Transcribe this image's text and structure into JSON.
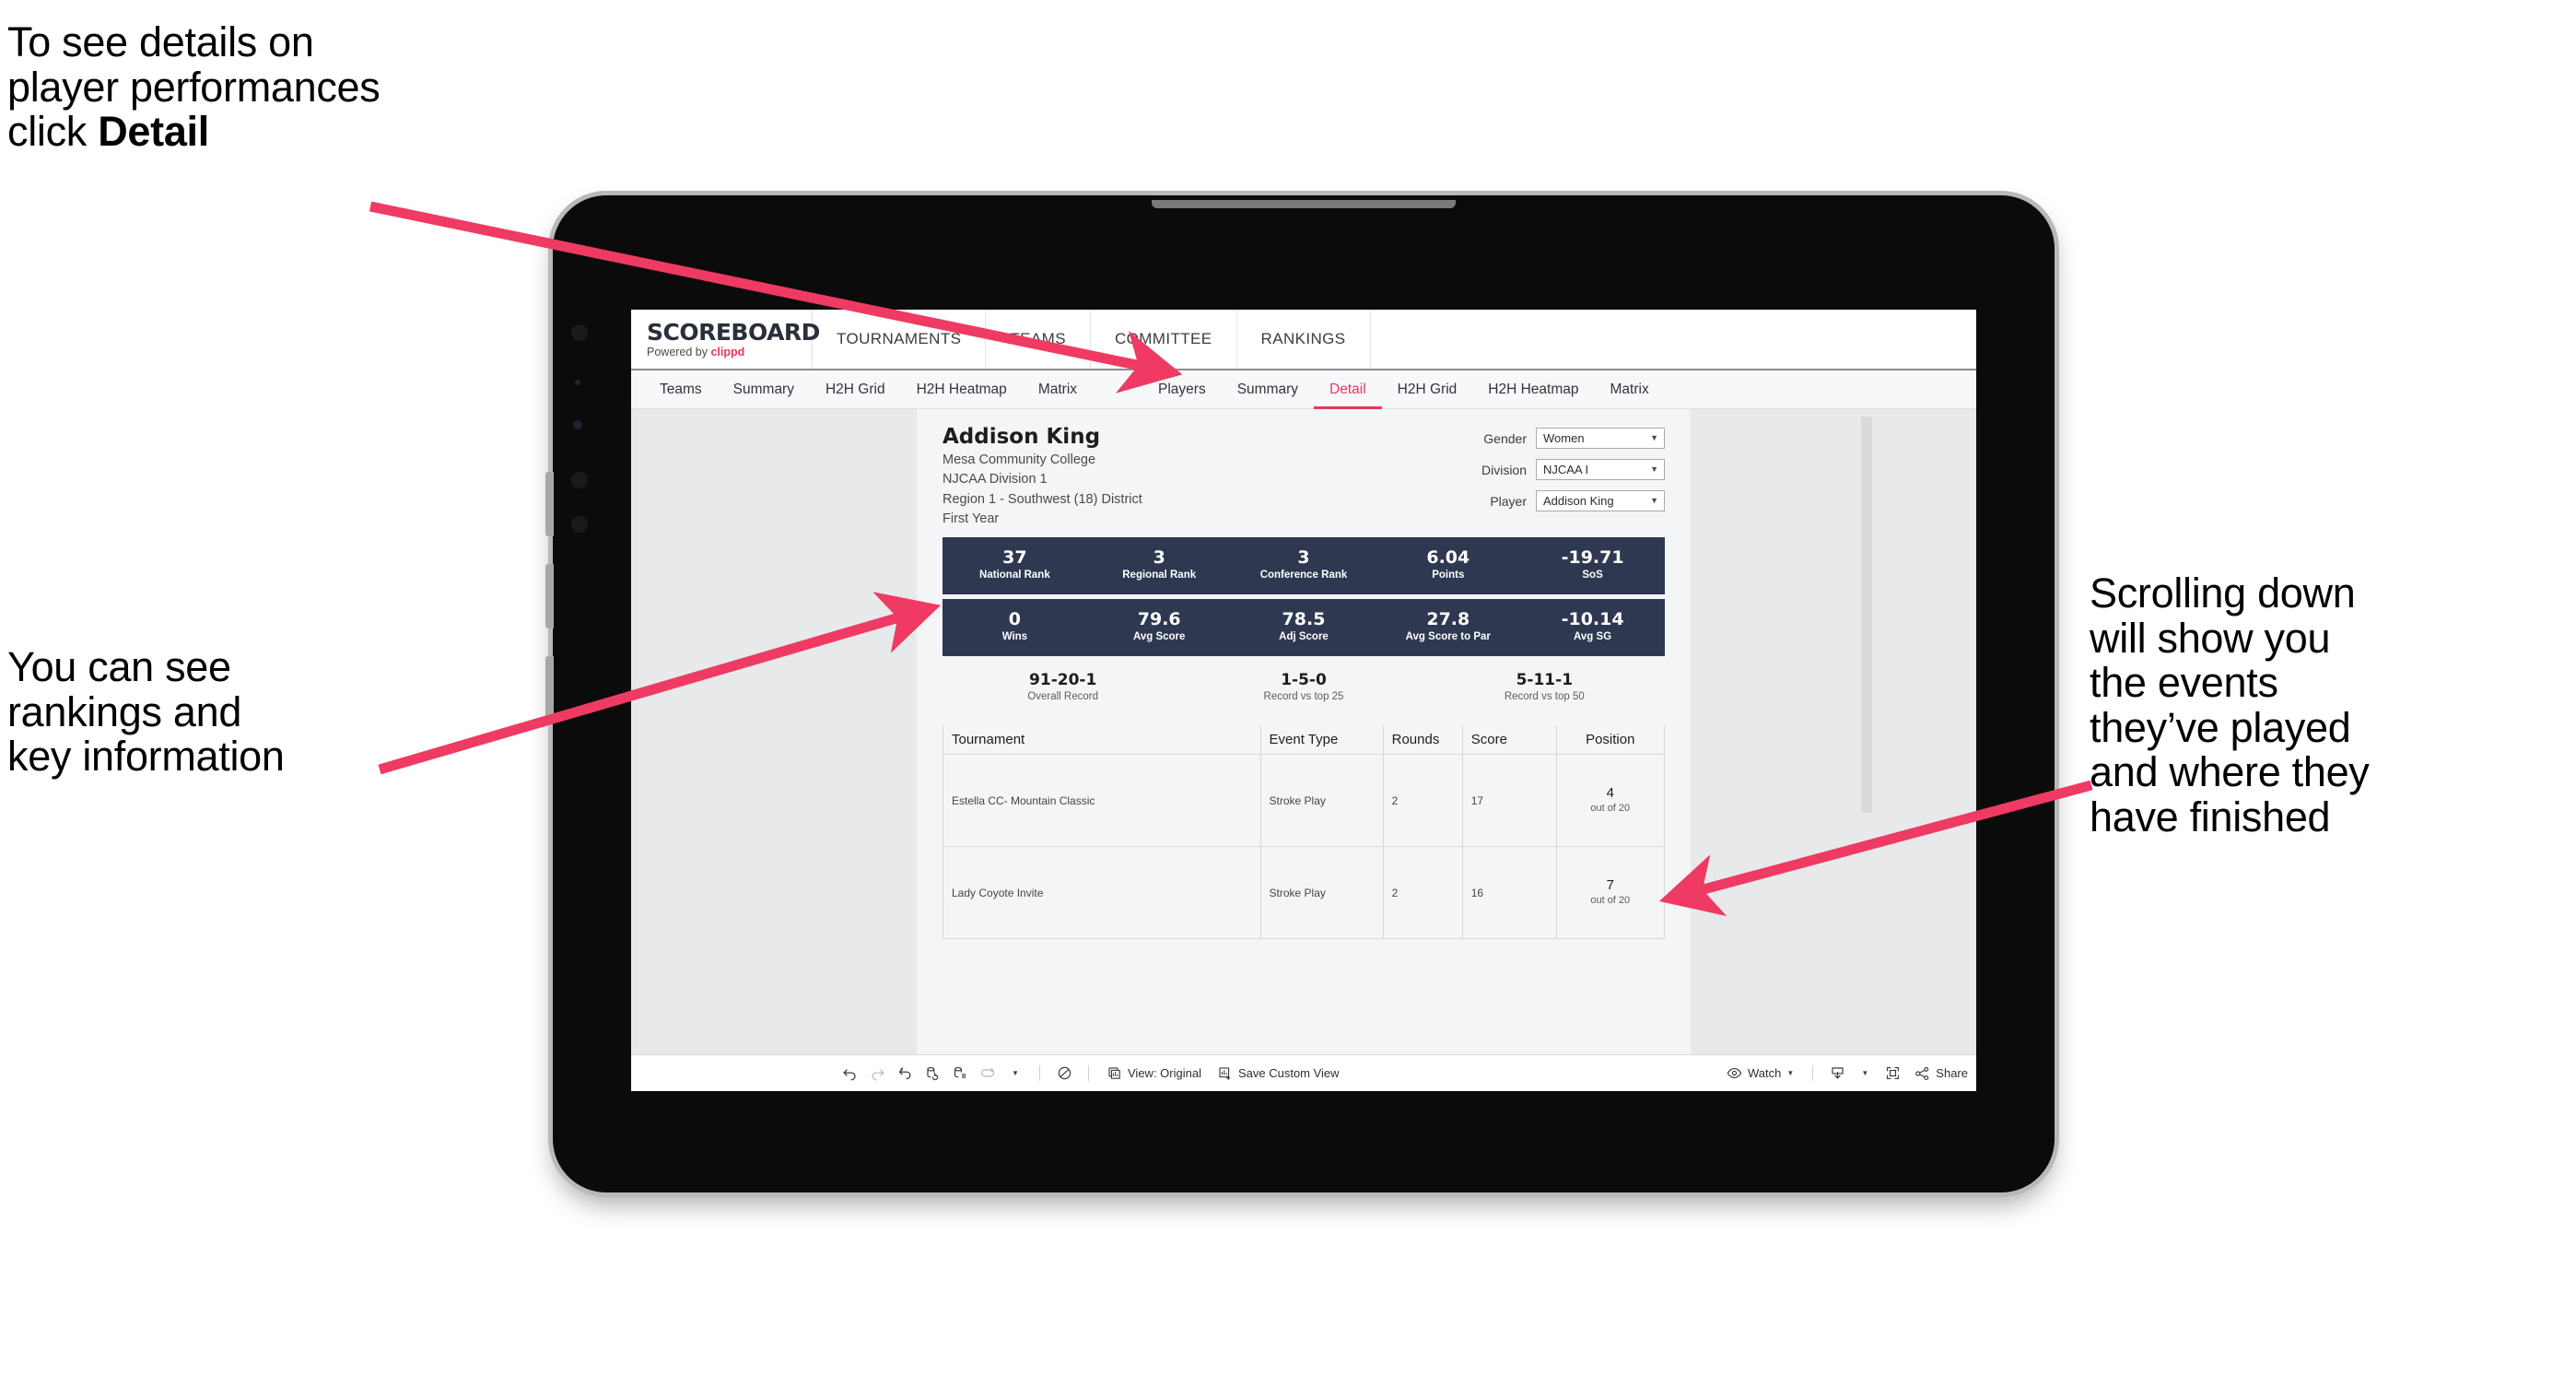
{
  "annotations": {
    "top_left": {
      "text_before": "To see details on\nplayer performances\nclick ",
      "bold": "Detail"
    },
    "left": {
      "text": "You can see\nrankings and\nkey information"
    },
    "right": {
      "text": "Scrolling down\nwill show you\nthe events\nthey’ve played\nand where they\nhave finished"
    },
    "arrow_color": "#ef3a63"
  },
  "app": {
    "brand": {
      "title": "SCOREBOARD",
      "powered_prefix": "Powered by ",
      "powered_brand": "clippd"
    },
    "topnav": [
      "TOURNAMENTS",
      "TEAMS",
      "COMMITTEE",
      "RANKINGS"
    ],
    "tabs_group_1": [
      "Teams",
      "Summary",
      "H2H Grid",
      "H2H Heatmap",
      "Matrix"
    ],
    "tabs_group_2": [
      "Players",
      "Summary",
      "Detail",
      "H2H Grid",
      "H2H Heatmap",
      "Matrix"
    ],
    "active_tab": "Detail",
    "accent_color": "#e8375f"
  },
  "player": {
    "name": "Addison King",
    "school": "Mesa Community College",
    "division": "NJCAA Division 1",
    "region": "Region 1 - Southwest (18) District",
    "year": "First Year"
  },
  "filters": [
    {
      "label": "Gender",
      "value": "Women"
    },
    {
      "label": "Division",
      "value": "NJCAA I"
    },
    {
      "label": "Player",
      "value": "Addison King"
    }
  ],
  "stats_row_1": [
    {
      "value": "37",
      "label": "National Rank"
    },
    {
      "value": "3",
      "label": "Regional Rank"
    },
    {
      "value": "3",
      "label": "Conference Rank"
    },
    {
      "value": "6.04",
      "label": "Points"
    },
    {
      "value": "-19.71",
      "label": "SoS"
    }
  ],
  "stats_row_2": [
    {
      "value": "0",
      "label": "Wins"
    },
    {
      "value": "79.6",
      "label": "Avg Score"
    },
    {
      "value": "78.5",
      "label": "Adj Score"
    },
    {
      "value": "27.8",
      "label": "Avg Score to Par"
    },
    {
      "value": "-10.14",
      "label": "Avg SG"
    }
  ],
  "records": [
    {
      "value": "91-20-1",
      "label": "Overall Record"
    },
    {
      "value": "1-5-0",
      "label": "Record vs top 25"
    },
    {
      "value": "5-11-1",
      "label": "Record vs top 50"
    }
  ],
  "events_table": {
    "columns": [
      "Tournament",
      "Event Type",
      "Rounds",
      "Score",
      "Position"
    ],
    "rows": [
      {
        "tournament": "Estella CC- Mountain Classic",
        "event_type": "Stroke Play",
        "rounds": "2",
        "score": "17",
        "position_num": "4",
        "position_of": "out of 20"
      },
      {
        "tournament": "Lady Coyote Invite",
        "event_type": "Stroke Play",
        "rounds": "2",
        "score": "16",
        "position_num": "7",
        "position_of": "out of 20"
      }
    ]
  },
  "toolbar": {
    "view_label": "View: Original",
    "save_label": "Save Custom View",
    "watch_label": "Watch",
    "share_label": "Share"
  }
}
